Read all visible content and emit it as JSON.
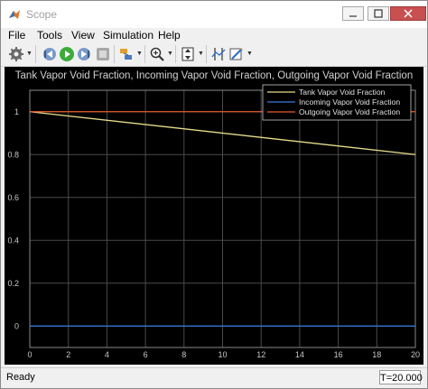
{
  "window": {
    "title": "Scope"
  },
  "menu": {
    "items": [
      "File",
      "Tools",
      "View",
      "Simulation",
      "Help"
    ]
  },
  "toolbar": {
    "icons": [
      "settings-icon",
      "step-back-icon",
      "run-icon",
      "step-forward-icon",
      "stop-icon",
      "highlight-icon",
      "zoom-icon",
      "scale-axes-icon",
      "cursor-measurements-icon",
      "style-icon"
    ]
  },
  "axes": {
    "title": "Tank Vapor Void Fraction, Incoming Vapor Void Fraction, Outgoing Vapor Void Fraction"
  },
  "chart_data": {
    "type": "line",
    "title": "Tank Vapor Void Fraction, Incoming Vapor Void Fraction, Outgoing Vapor Void Fraction",
    "xlabel": "",
    "ylabel": "",
    "xlim": [
      0,
      20
    ],
    "ylim": [
      -0.1,
      1.1
    ],
    "xticks": [
      "0",
      "2",
      "4",
      "6",
      "8",
      "10",
      "12",
      "14",
      "16",
      "18",
      "20"
    ],
    "yticks": [
      "0",
      "0.2",
      "0.4",
      "0.6",
      "0.8",
      "1"
    ],
    "grid": true,
    "legend_position": "top-right",
    "series": [
      {
        "name": "Tank Vapor Void Fraction",
        "color": "#e6dc8c",
        "x": [
          0,
          20
        ],
        "y": [
          1,
          0.8
        ]
      },
      {
        "name": "Incoming Vapor Void Fraction",
        "color": "#3c78dc",
        "x": [
          0,
          20
        ],
        "y": [
          0,
          0
        ]
      },
      {
        "name": "Outgoing Vapor Void Fraction",
        "color": "#e65a2a",
        "x": [
          0,
          20
        ],
        "y": [
          1,
          1
        ]
      }
    ]
  },
  "status": {
    "text": "Ready",
    "time": "T=20.000"
  },
  "colors": {
    "figure_bg": "#000000",
    "axes_bg": "#000000",
    "grid": "#4a4a4a",
    "axes_frame": "#8a8a8a",
    "tick_text": "#c8c8c8"
  }
}
